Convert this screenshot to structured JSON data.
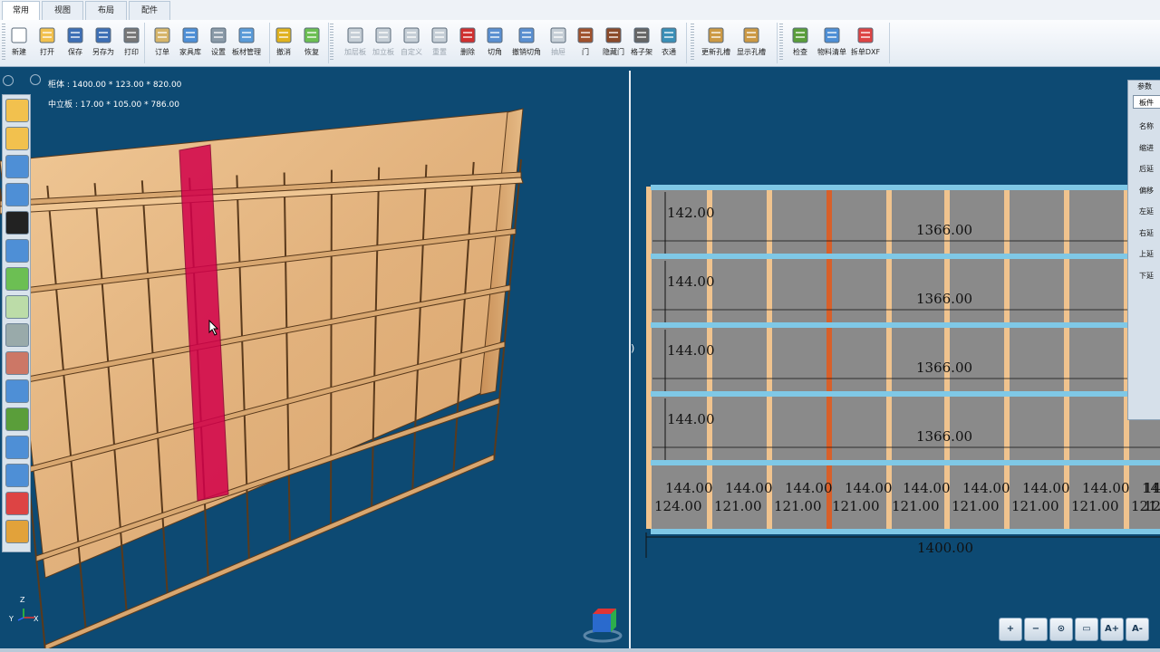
{
  "tabs": [
    {
      "label": "常用"
    },
    {
      "label": "视图"
    },
    {
      "label": "布局"
    },
    {
      "label": "配件"
    }
  ],
  "toolbar": {
    "file": [
      {
        "label": "新建",
        "icon": "new-doc-icon"
      },
      {
        "label": "打开",
        "icon": "open-folder-icon"
      },
      {
        "label": "保存",
        "icon": "save-icon"
      },
      {
        "label": "另存为",
        "icon": "save-as-icon"
      },
      {
        "label": "打印",
        "icon": "print-icon"
      }
    ],
    "manage": [
      {
        "label": "订单",
        "icon": "order-icon"
      },
      {
        "label": "家具库",
        "icon": "furniture-library-icon"
      },
      {
        "label": "设置",
        "icon": "gear-icon"
      },
      {
        "label": "板材管理",
        "icon": "board-manage-icon"
      }
    ],
    "undo": [
      {
        "label": "撤消",
        "icon": "undo-icon"
      },
      {
        "label": "恢复",
        "icon": "redo-icon"
      }
    ],
    "edit": [
      {
        "label": "加层板",
        "icon": "add-shelf-icon",
        "disabled": true
      },
      {
        "label": "加立板",
        "icon": "add-vertical-board-icon",
        "disabled": true
      },
      {
        "label": "自定义",
        "icon": "custom-icon",
        "disabled": true
      },
      {
        "label": "重置",
        "icon": "reset-icon",
        "disabled": true
      },
      {
        "label": "删除",
        "icon": "delete-icon"
      },
      {
        "label": "切角",
        "icon": "cut-corner-icon"
      },
      {
        "label": "撤销切角",
        "icon": "undo-cut-corner-icon"
      },
      {
        "label": "抽屉",
        "icon": "drawer-icon",
        "disabled": true
      },
      {
        "label": "门",
        "icon": "door-icon"
      },
      {
        "label": "隐藏门",
        "icon": "hide-door-icon"
      },
      {
        "label": "格子架",
        "icon": "grid-rack-icon"
      },
      {
        "label": "衣通",
        "icon": "hanging-rod-icon"
      }
    ],
    "holes": [
      {
        "label": "更新孔槽",
        "icon": "update-holes-icon"
      },
      {
        "label": "显示孔槽",
        "icon": "show-holes-icon"
      }
    ],
    "export": [
      {
        "label": "检查",
        "icon": "check-icon"
      },
      {
        "label": "物料清单",
        "icon": "bom-icon"
      },
      {
        "label": "拆单DXF",
        "icon": "dxf-export-icon"
      }
    ]
  },
  "view3d": {
    "cabinet_info": "柜体 : 1400.00 * 123.00 * 820.00",
    "partition_info": "中立板 : 17.00 * 105.00 * 786.00",
    "axis_z": "Z",
    "axis_x": "X",
    "axis_y": "Y",
    "panel_color": "#e8b98a",
    "selected_color": "#d2004a"
  },
  "view2d": {
    "rows": [
      {
        "height": "142.00",
        "width": "1366.00"
      },
      {
        "height": "144.00",
        "width": "1366.00"
      },
      {
        "height": "144.00",
        "width": "1366.00"
      },
      {
        "height": "144.00",
        "width": "1366.00"
      }
    ],
    "bottom_top_labels": [
      "144.00",
      "144.00",
      "144.00",
      "144.00",
      "144.00",
      "144.00",
      "144.00",
      "144.00",
      "144.00",
      "14"
    ],
    "bottom_bottom_labels": [
      "124.00",
      "121.00",
      "121.00",
      "121.00",
      "121.00",
      "121.00",
      "121.00",
      "121.00",
      "121.00",
      "12"
    ],
    "total_width": "1400.00",
    "left_mark": ")",
    "shelf_color": "#7fc8e6",
    "divider_color": "#f0c38e",
    "selected_divider_color": "#d8602a",
    "cell_color": "#8a8a8a"
  },
  "params": {
    "title": "参数",
    "field_value": "板件",
    "labels": [
      "名称",
      "缩进",
      "后延",
      "偏移",
      "左延",
      "右延",
      "上延",
      "下延"
    ]
  },
  "zoom": [
    "+",
    "−",
    "⊙",
    "▭",
    "A+",
    "A-"
  ]
}
